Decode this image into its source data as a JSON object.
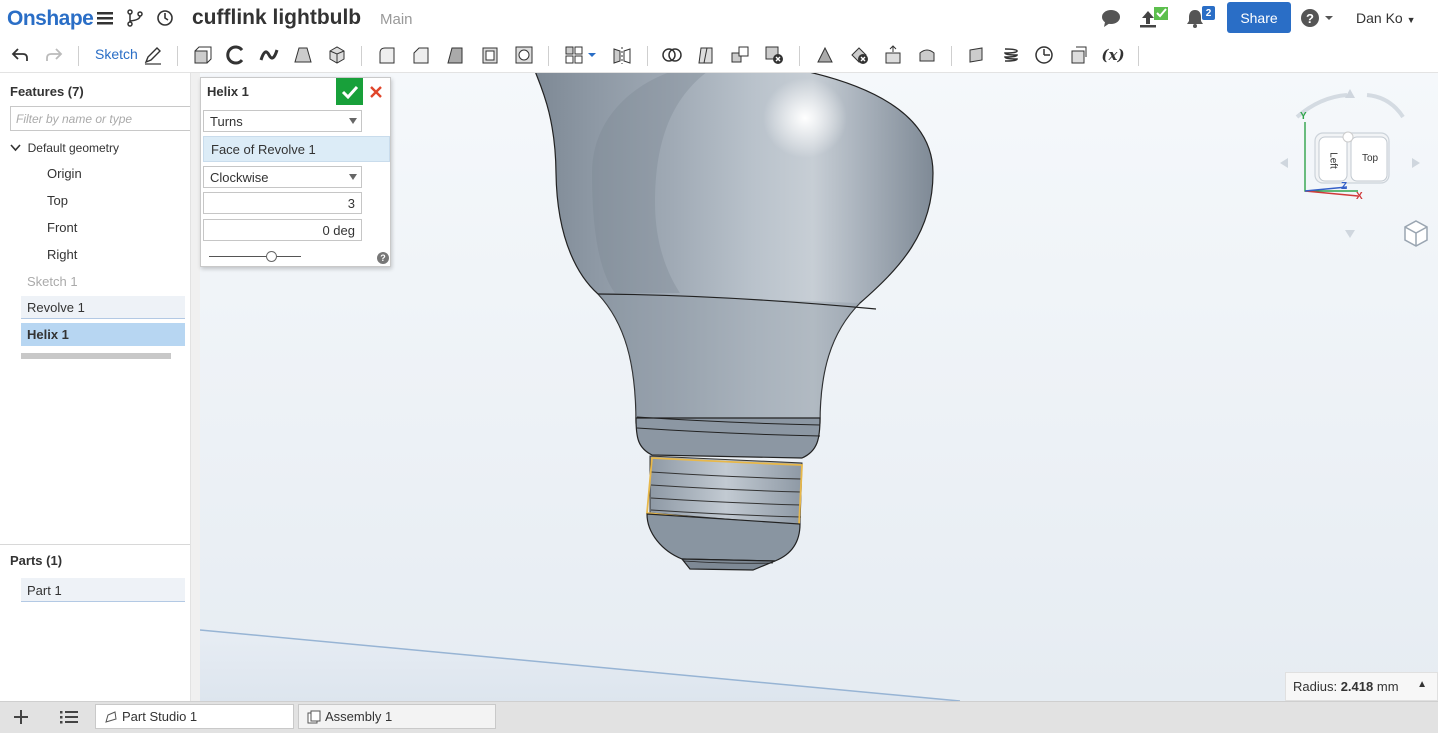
{
  "app": {
    "logo": "Onshape"
  },
  "document": {
    "title": "cufflink lightbulb",
    "branch": "Main"
  },
  "header": {
    "share_label": "Share",
    "user_name": "Dan Ko",
    "notification_count": "2"
  },
  "toolbar": {
    "sketch_label": "Sketch",
    "variable_label": "(x)"
  },
  "features": {
    "header": "Features (7)",
    "filter_placeholder": "Filter by name or type",
    "default_geometry": "Default geometry",
    "planes": [
      "Origin",
      "Top",
      "Front",
      "Right"
    ],
    "items": [
      "Sketch 1",
      "Revolve 1",
      "Helix 1"
    ]
  },
  "parts": {
    "header": "Parts (1)",
    "items": [
      "Part 1"
    ]
  },
  "helix_dialog": {
    "title": "Helix 1",
    "mode": "Turns",
    "selection": "Face of Revolve 1",
    "direction": "Clockwise",
    "turns": "3",
    "angle": "0 deg",
    "slider_level": 0.68
  },
  "view_cube": {
    "faces": [
      "Left",
      "Top"
    ],
    "axes": [
      "Y",
      "Z",
      "X"
    ]
  },
  "status": {
    "radius_label": "Radius:",
    "radius_value": "2.418",
    "radius_unit": "mm"
  },
  "tabs": [
    {
      "label": "Part Studio 1",
      "active": true
    },
    {
      "label": "Assembly 1",
      "active": false
    }
  ],
  "colors": {
    "brand_blue": "#2a6ec6",
    "selection_highlight": "#b7d6f2",
    "confirm_green": "#18a03a",
    "cancel_red": "#e0452a",
    "edge_highlight": "#e8b84a"
  }
}
